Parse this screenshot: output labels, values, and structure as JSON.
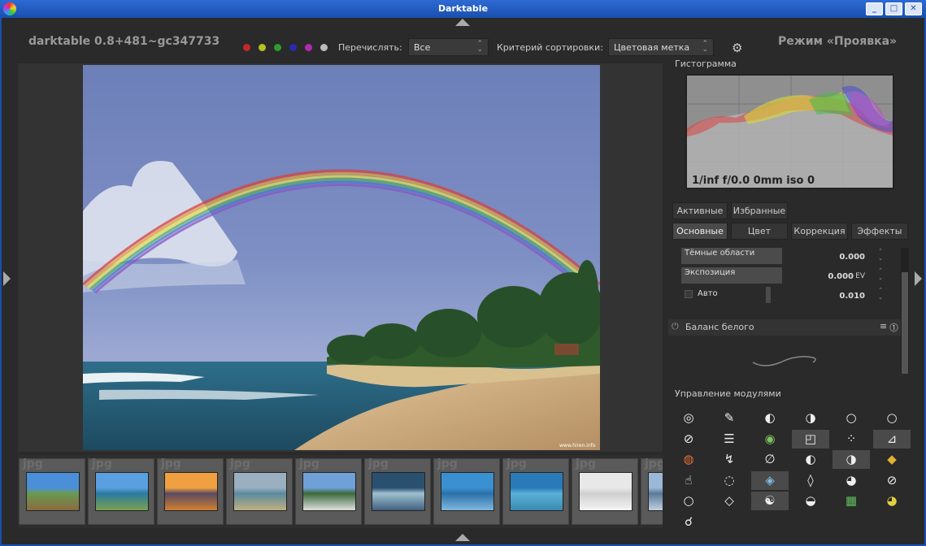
{
  "window": {
    "title": "Darktable"
  },
  "header": {
    "app_version": "darktable 0.8+481~gc347733",
    "color_labels": [
      "#c62828",
      "#b5c21f",
      "#2e9e2e",
      "#2a2ab0",
      "#b02ab0",
      "#bbbbbb"
    ],
    "filter_label": "Перечислять:",
    "filter_value": "Все",
    "sort_label": "Критерий сортировки:",
    "sort_value": "Цветовая метка",
    "mode_title": "Режим «Проявка»"
  },
  "image": {
    "credit": "www.hiren.info"
  },
  "filmstrip": {
    "badge": "jpg",
    "count_visible": 10
  },
  "panel": {
    "histogram_title": "Гистограмма",
    "histogram_info": "1/inf f/0.0 0mm iso 0",
    "group_tabs_row1": [
      "Активные",
      "Избранные"
    ],
    "group_tabs_row2": [
      "Основные",
      "Цвет",
      "Коррекция",
      "Эффекты"
    ],
    "sliders": [
      {
        "label": "Тёмные области",
        "value": "0.000",
        "unit": ""
      },
      {
        "label": "Экспозиция",
        "value": "0.000",
        "unit": "EV"
      },
      {
        "label": "Авто",
        "value": "0.010",
        "unit": ""
      }
    ],
    "wb_title": "Баланс белого",
    "modules_title": "Управление модулями"
  }
}
